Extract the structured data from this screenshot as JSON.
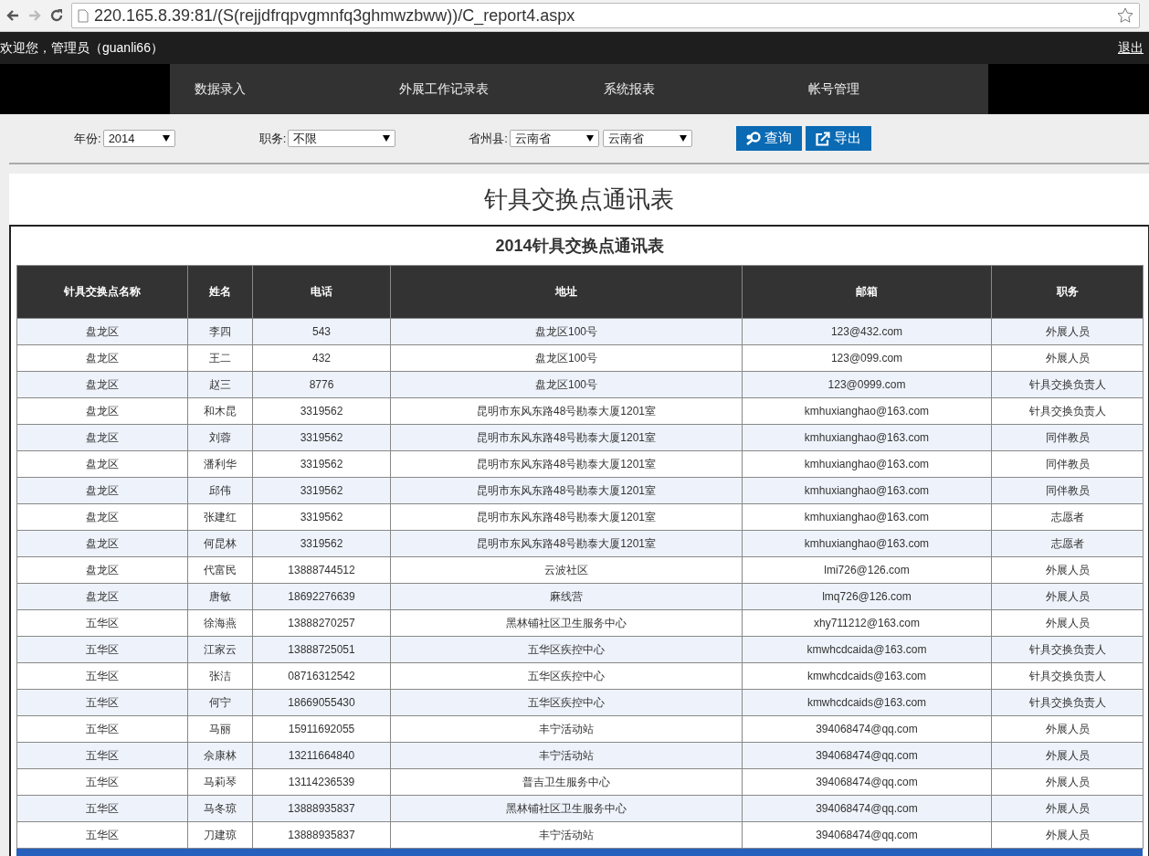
{
  "browser": {
    "url": "220.165.8.39:81/(S(rejjdfrqpvgmnfq3ghmwzbww))/C_report4.aspx"
  },
  "top_bar": {
    "welcome": "欢迎您，管理员（guanli66）",
    "logout": "退出"
  },
  "nav": {
    "items": [
      "数据录入",
      "外展工作记录表",
      "系统报表",
      "帐号管理"
    ]
  },
  "filters": [
    {
      "label": "年份:",
      "selects": [
        "2014"
      ]
    },
    {
      "label": "职务:",
      "selects": [
        "不限"
      ]
    },
    {
      "label": "省州县:",
      "selects": [
        "云南省",
        "云南省"
      ]
    }
  ],
  "buttons": [
    {
      "label": "查询",
      "kind": "search"
    },
    {
      "label": "导出",
      "kind": "export"
    }
  ],
  "page_title": "针具交换点通讯表",
  "table": {
    "caption": "2014针具交换点通讯表",
    "columns": [
      "针具交换点名称",
      "姓名",
      "电话",
      "地址",
      "邮箱",
      "职务"
    ],
    "rows": [
      [
        "盘龙区",
        "李四",
        "543",
        "盘龙区100号",
        "123@432.com",
        "外展人员"
      ],
      [
        "盘龙区",
        "王二",
        "432",
        "盘龙区100号",
        "123@099.com",
        "外展人员"
      ],
      [
        "盘龙区",
        "赵三",
        "8776",
        "盘龙区100号",
        "123@0999.com",
        "针具交换负责人"
      ],
      [
        "盘龙区",
        "和木昆",
        "3319562",
        "昆明市东风东路48号勘泰大厦1201室",
        "kmhuxianghao@163.com",
        "针具交换负责人"
      ],
      [
        "盘龙区",
        "刘蓉",
        "3319562",
        "昆明市东风东路48号勘泰大厦1201室",
        "kmhuxianghao@163.com",
        "同伴教员"
      ],
      [
        "盘龙区",
        "潘利华",
        "3319562",
        "昆明市东风东路48号勘泰大厦1201室",
        "kmhuxianghao@163.com",
        "同伴教员"
      ],
      [
        "盘龙区",
        "邱伟",
        "3319562",
        "昆明市东风东路48号勘泰大厦1201室",
        "kmhuxianghao@163.com",
        "同伴教员"
      ],
      [
        "盘龙区",
        "张建红",
        "3319562",
        "昆明市东风东路48号勘泰大厦1201室",
        "kmhuxianghao@163.com",
        "志愿者"
      ],
      [
        "盘龙区",
        "何昆林",
        "3319562",
        "昆明市东风东路48号勘泰大厦1201室",
        "kmhuxianghao@163.com",
        "志愿者"
      ],
      [
        "盘龙区",
        "代富民",
        "13888744512",
        "云波社区",
        "lmi726@126.com",
        "外展人员"
      ],
      [
        "盘龙区",
        "唐敏",
        "18692276639",
        "麻线营",
        "lmq726@126.com",
        "外展人员"
      ],
      [
        "五华区",
        "徐海燕",
        "13888270257",
        "黑林铺社区卫生服务中心",
        "xhy711212@163.com",
        "外展人员"
      ],
      [
        "五华区",
        "江家云",
        "13888725051",
        "五华区疾控中心",
        "kmwhcdcaida@163.com",
        "针具交换负责人"
      ],
      [
        "五华区",
        "张洁",
        "08716312542",
        "五华区疾控中心",
        "kmwhcdcaids@163.com",
        "针具交换负责人"
      ],
      [
        "五华区",
        "何宁",
        "18669055430",
        "五华区疾控中心",
        "kmwhcdcaids@163.com",
        "针具交换负责人"
      ],
      [
        "五华区",
        "马丽",
        "15911692055",
        "丰宁活动站",
        "394068474@qq.com",
        "外展人员"
      ],
      [
        "五华区",
        "佘康林",
        "13211664840",
        "丰宁活动站",
        "394068474@qq.com",
        "外展人员"
      ],
      [
        "五华区",
        "马莉琴",
        "13114236539",
        "普吉卫生服务中心",
        "394068474@qq.com",
        "外展人员"
      ],
      [
        "五华区",
        "马冬琼",
        "13888935837",
        "黑林铺社区卫生服务中心",
        "394068474@qq.com",
        "外展人员"
      ],
      [
        "五华区",
        "刀建琼",
        "13888935837",
        "丰宁活动站",
        "394068474@qq.com",
        "外展人员"
      ]
    ]
  }
}
